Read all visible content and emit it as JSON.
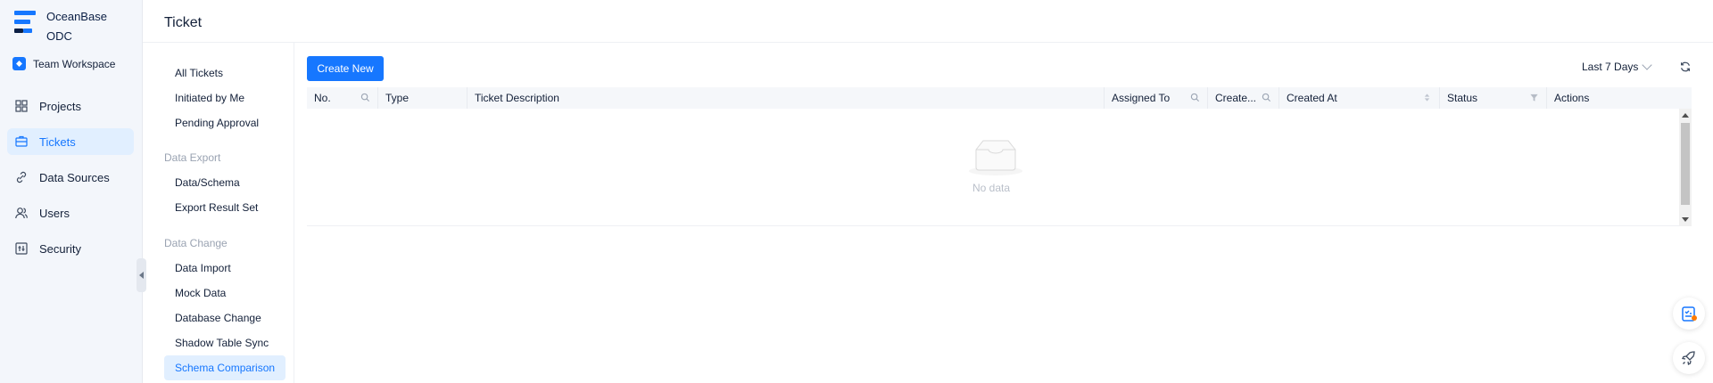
{
  "brand": {
    "line1": "OceanBase",
    "line2": "ODC"
  },
  "workspace": {
    "label": "Team Workspace"
  },
  "nav": {
    "items": [
      {
        "label": "Projects",
        "icon": "grid-icon"
      },
      {
        "label": "Tickets",
        "icon": "ticket-icon",
        "active": true
      },
      {
        "label": "Data Sources",
        "icon": "link-icon"
      },
      {
        "label": "Users",
        "icon": "users-icon"
      },
      {
        "label": "Security",
        "icon": "security-icon"
      }
    ]
  },
  "header": {
    "title": "Ticket"
  },
  "submenu": {
    "top": [
      "All Tickets",
      "Initiated by Me",
      "Pending Approval"
    ],
    "groups": [
      {
        "title": "Data Export",
        "items": [
          "Data/Schema",
          "Export Result Set"
        ]
      },
      {
        "title": "Data Change",
        "items": [
          "Data Import",
          "Mock Data",
          "Database Change",
          "Shadow Table Sync",
          "Schema Comparison"
        ]
      }
    ],
    "active": "Schema Comparison"
  },
  "toolbar": {
    "create_label": "Create New",
    "range_label": "Last 7 Days"
  },
  "table": {
    "columns": [
      "No.",
      "Type",
      "Ticket Description",
      "Assigned To",
      "Create...",
      "Created At",
      "Status",
      "Actions"
    ],
    "empty_text": "No data"
  },
  "colors": {
    "accent": "#1677ff",
    "nav_bg": "#f3f6fb",
    "active_bg": "#e1efff"
  }
}
